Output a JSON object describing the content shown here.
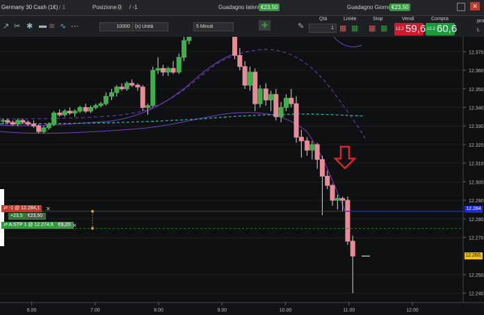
{
  "titlebar": {
    "title": "Germany 30 Cash (1€)",
    "pager": "/ 1",
    "position_label": "Posizione:",
    "position_value": "0",
    "position_total": "/ -1",
    "latent_label": "Guadagno latente:",
    "latent_value": "€23,50",
    "daily_label": "Guadagno Giorno:",
    "daily_value": "€23,50"
  },
  "toolbar": {
    "quantity": "10000",
    "unit": "(x) Unità",
    "timeframe": "5 Minuti",
    "qty_label": "Qtà",
    "qty_value": "1",
    "limit_label": "Limite",
    "stop_label": "Stop",
    "sell_label": "Vendi",
    "buy_label": "Compra",
    "sell_prefix": "12.2",
    "sell_big": "59,6",
    "buy_prefix": "12.2",
    "buy_big": "60,6",
    "side_label_1": "pro",
    "side_label_2": "L"
  },
  "orders": {
    "short_position": "-1 @ 12.284,1",
    "short_pnl": "+23,5",
    "short_pnl_eur": "€23,50",
    "stop_order": "A:STP 1 @ 12.274,9",
    "stop_eur": "€9,20"
  },
  "price_tags": {
    "blue_level": "12.284",
    "current": "12.260,"
  },
  "chart_data": {
    "type": "candlestick",
    "timeframe": "5 Minuti",
    "x_ticks": [
      "6.00",
      "7.00",
      "8.00",
      "9.00",
      "10.00",
      "11.00",
      "12.00"
    ],
    "y_ticks": [
      "12.370",
      "12.360",
      "12.350",
      "12.340",
      "12.330",
      "12.320",
      "12.310",
      "12.300",
      "12.290",
      "12.280",
      "12.270",
      "12.250",
      "12.240"
    ],
    "y_tick_values": [
      12370,
      12360,
      12350,
      12340,
      12330,
      12320,
      12310,
      12300,
      12290,
      12280,
      12270,
      12250,
      12240
    ],
    "ylim": [
      12235,
      12378
    ],
    "xlim": [
      5.5,
      12.8
    ],
    "levels": {
      "position_entry": 12284.1,
      "stop": 12274.9,
      "current": 12260
    },
    "colors": {
      "bull": "#3fb04b",
      "bear": "#e58c97",
      "ma": "#7b3fc2",
      "ema": "#1ec2b3",
      "entry": "#1c2ad8"
    },
    "candles": [
      [
        5.55,
        12333,
        12334,
        12331,
        12333
      ],
      [
        5.62,
        12333,
        12334,
        12331,
        12332
      ],
      [
        5.7,
        12332,
        12333,
        12330,
        12331
      ],
      [
        5.78,
        12331,
        12334,
        12330,
        12333
      ],
      [
        5.86,
        12333,
        12334,
        12331,
        12332
      ],
      [
        5.94,
        12332,
        12333,
        12330,
        12331
      ],
      [
        6.03,
        12331,
        12333,
        12329,
        12330
      ],
      [
        6.11,
        12330,
        12331,
        12326,
        12327
      ],
      [
        6.19,
        12327,
        12330,
        12326,
        12329
      ],
      [
        6.27,
        12329,
        12332,
        12328,
        12331
      ],
      [
        6.35,
        12331,
        12338,
        12330,
        12337
      ],
      [
        6.44,
        12337,
        12339,
        12335,
        12336
      ],
      [
        6.52,
        12336,
        12339,
        12335,
        12338
      ],
      [
        6.6,
        12338,
        12340,
        12336,
        12337
      ],
      [
        6.68,
        12337,
        12339,
        12335,
        12338
      ],
      [
        6.76,
        12338,
        12341,
        12337,
        12340
      ],
      [
        6.85,
        12340,
        12342,
        12337,
        12338
      ],
      [
        6.93,
        12338,
        12341,
        12337,
        12340
      ],
      [
        7.01,
        12340,
        12342,
        12339,
        12341
      ],
      [
        7.09,
        12341,
        12343,
        12340,
        12342
      ],
      [
        7.17,
        12342,
        12348,
        12341,
        12346
      ],
      [
        7.26,
        12346,
        12350,
        12344,
        12348
      ],
      [
        7.34,
        12348,
        12352,
        12346,
        12351
      ],
      [
        7.42,
        12351,
        12353,
        12349,
        12350
      ],
      [
        7.5,
        12350,
        12354,
        12349,
        12353
      ],
      [
        7.58,
        12353,
        12355,
        12351,
        12352
      ],
      [
        7.67,
        12352,
        12353,
        12349,
        12351
      ],
      [
        7.75,
        12351,
        12352,
        12338,
        12340
      ],
      [
        7.83,
        12340,
        12342,
        12336,
        12341
      ],
      [
        7.91,
        12341,
        12362,
        12340,
        12360
      ],
      [
        7.99,
        12360,
        12367,
        12358,
        12361
      ],
      [
        8.07,
        12361,
        12363,
        12357,
        12359
      ],
      [
        8.15,
        12359,
        12362,
        12357,
        12361
      ],
      [
        8.23,
        12361,
        12365,
        12358,
        12359
      ],
      [
        8.32,
        12359,
        12369,
        12358,
        12367
      ],
      [
        8.4,
        12367,
        12378,
        12365,
        12376
      ],
      [
        8.48,
        12376,
        12382,
        12374,
        12380
      ],
      [
        9.2,
        12380,
        12382,
        12366,
        12368
      ],
      [
        9.28,
        12368,
        12372,
        12360,
        12362
      ],
      [
        9.36,
        12362,
        12365,
        12350,
        12352
      ],
      [
        9.44,
        12352,
        12362,
        12349,
        12359
      ],
      [
        9.52,
        12359,
        12361,
        12338,
        12342
      ],
      [
        9.6,
        12342,
        12352,
        12340,
        12350
      ],
      [
        9.69,
        12350,
        12353,
        12341,
        12344
      ],
      [
        9.77,
        12344,
        12349,
        12338,
        12347
      ],
      [
        9.85,
        12347,
        12350,
        12333,
        12335
      ],
      [
        9.93,
        12335,
        12343,
        12332,
        12340
      ],
      [
        10.01,
        12340,
        12347,
        12338,
        12345
      ],
      [
        10.09,
        12345,
        12350,
        12340,
        12342
      ],
      [
        10.17,
        12342,
        12346,
        12321,
        12324
      ],
      [
        10.25,
        12324,
        12328,
        12313,
        12322
      ],
      [
        10.34,
        12322,
        12324,
        12314,
        12317
      ],
      [
        10.42,
        12317,
        12322,
        12312,
        12320
      ],
      [
        10.5,
        12320,
        12321,
        12307,
        12312
      ],
      [
        10.58,
        12312,
        12314,
        12282,
        12303
      ],
      [
        10.66,
        12303,
        12306,
        12296,
        12298
      ],
      [
        10.74,
        12298,
        12299,
        12287,
        12290
      ],
      [
        10.82,
        12290,
        12293,
        12285,
        12291
      ],
      [
        10.9,
        12291,
        12292,
        12284,
        12290
      ],
      [
        10.98,
        12290,
        12292,
        12266,
        12268
      ],
      [
        11.06,
        12268,
        12271,
        12240,
        12260
      ]
    ]
  }
}
